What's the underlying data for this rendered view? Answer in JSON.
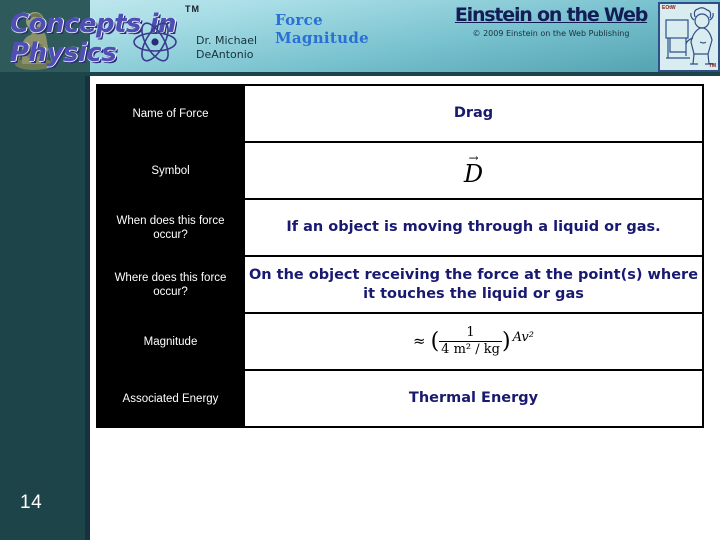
{
  "banner": {
    "logo": {
      "line1": "Concepts in",
      "line2": "Physics",
      "trademark": "TM",
      "statue_icon": "thinker-statue-icon",
      "atom_icon": "atom-icon"
    },
    "author": "Dr. Michael\nDeAntonio",
    "deck_title": "Force\nMagnitude",
    "publisher": {
      "title": "Einstein on the Web",
      "copyright": "© 2009 Einstein on the  Web Publishing",
      "badge_label": "EOtW",
      "badge_tm": "TM",
      "badge_icon": "einstein-at-computer-icon"
    },
    "colors": {
      "gradient_start": "#c8eaf0",
      "gradient_end": "#4e9eae",
      "title_blue": "#2a6fd4",
      "logo_purple": "#4e4eb4"
    }
  },
  "sidebar": {
    "page_number": "14",
    "color": "#1d4449",
    "edge_color": "#16313f"
  },
  "table": {
    "label_bg": "#000000",
    "label_fg": "#ffffff",
    "value_fg": "#191970",
    "rows": [
      {
        "label": "Name of Force",
        "value": "Drag",
        "type": "text"
      },
      {
        "label": "Symbol",
        "value": "D",
        "vector_accent": "→",
        "type": "symbol"
      },
      {
        "label": "When does this force occur?",
        "value": "If an object is moving through a liquid or gas.",
        "type": "text"
      },
      {
        "label": "Where does this force occur?",
        "value": "On the object receiving the force at the point(s) where it touches the liquid or gas",
        "type": "text"
      },
      {
        "label": "Magnitude",
        "type": "formula",
        "formula": {
          "approx": "≈",
          "numerator": "1",
          "denominator": "4 m² / kg",
          "tail": "Av²"
        }
      },
      {
        "label": "Associated Energy",
        "value": "Thermal Energy",
        "type": "text"
      }
    ]
  }
}
